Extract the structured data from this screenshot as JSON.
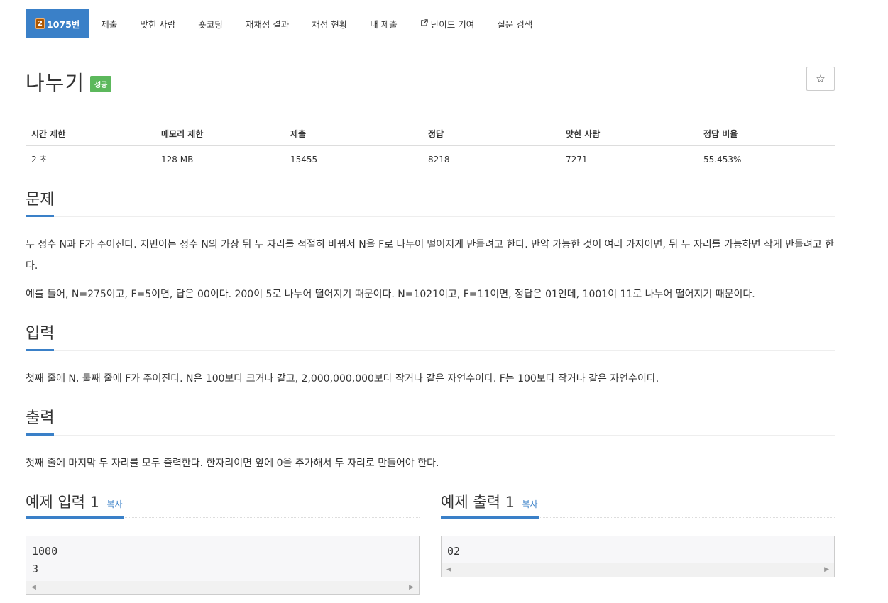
{
  "tabs": [
    {
      "label": "1075번",
      "tier": "2",
      "active": true
    },
    {
      "label": "제출"
    },
    {
      "label": "맞힌 사람"
    },
    {
      "label": "숏코딩"
    },
    {
      "label": "재채점 결과"
    },
    {
      "label": "채점 현황"
    },
    {
      "label": "내 제출"
    },
    {
      "label": "난이도 기여",
      "icon": "external-link-icon"
    },
    {
      "label": "질문 검색"
    }
  ],
  "problem": {
    "title": "나누기",
    "status": "성공",
    "star": "☆"
  },
  "info": {
    "headers": [
      "시간 제한",
      "메모리 제한",
      "제출",
      "정답",
      "맞힌 사람",
      "정답 비율"
    ],
    "values": [
      "2 초",
      "128 MB",
      "15455",
      "8218",
      "7271",
      "55.453%"
    ]
  },
  "sections": {
    "description": {
      "title": "문제",
      "paragraphs": [
        "두 정수 N과 F가 주어진다. 지민이는 정수 N의 가장 뒤 두 자리를 적절히 바꿔서 N을 F로 나누어 떨어지게 만들려고 한다. 만약 가능한 것이 여러 가지이면, 뒤 두 자리를 가능하면 작게 만들려고 한다.",
        "예를 들어, N=275이고, F=5이면, 답은 00이다. 200이 5로 나누어 떨어지기 때문이다. N=1021이고, F=11이면, 정답은 01인데, 1001이 11로 나누어 떨어지기 때문이다."
      ]
    },
    "input": {
      "title": "입력",
      "text": "첫째 줄에 N, 둘째 줄에 F가 주어진다. N은 100보다 크거나 같고, 2,000,000,000보다 작거나 같은 자연수이다. F는 100보다 작거나 같은 자연수이다."
    },
    "output": {
      "title": "출력",
      "text": "첫째 줄에 마지막 두 자리를 모두 출력한다. 한자리이면 앞에 0을 추가해서 두 자리로 만들어야 한다."
    }
  },
  "samples": {
    "input": {
      "title": "예제 입력 1",
      "copy": "복사",
      "content": "1000\n3"
    },
    "output": {
      "title": "예제 출력 1",
      "copy": "복사",
      "content": "02"
    }
  },
  "colors": {
    "accent": "#3a80c8",
    "success": "#5cb85c",
    "tier": "#ad5600"
  }
}
